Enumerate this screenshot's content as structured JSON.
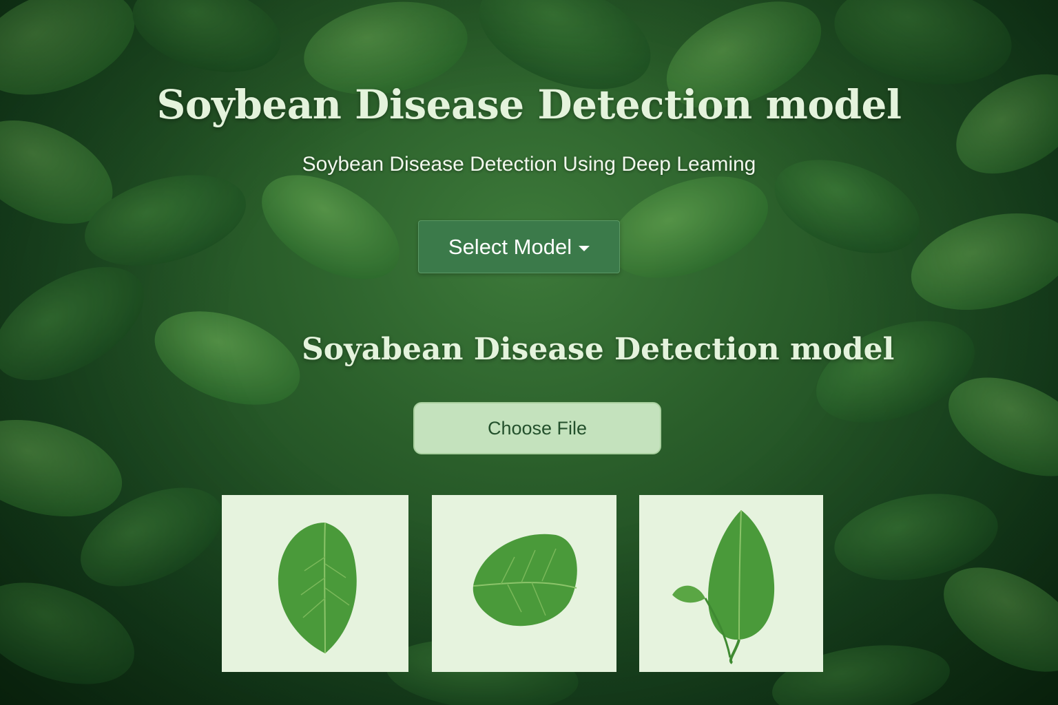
{
  "page": {
    "title": "Soybean Disease Detection model",
    "subtitle": "Soybean Disease Detection Using Deep Leaming"
  },
  "controls": {
    "select_model_label": "Select Model",
    "section_title": "Soyabean Disease Detection model",
    "choose_file_label": "Choose File"
  },
  "sample_images": [
    {
      "name": "leaf-sample-1"
    },
    {
      "name": "leaf-sample-2"
    },
    {
      "name": "leaf-sample-3"
    }
  ],
  "colors": {
    "title_text": "#e4f3dc",
    "select_button": "#3b7a4a",
    "choose_file_bg": "#c4e2bd",
    "choose_file_text": "#23502c",
    "thumbnail_bg": "#e6f3de",
    "leaf_green": "#4a9a3a"
  }
}
